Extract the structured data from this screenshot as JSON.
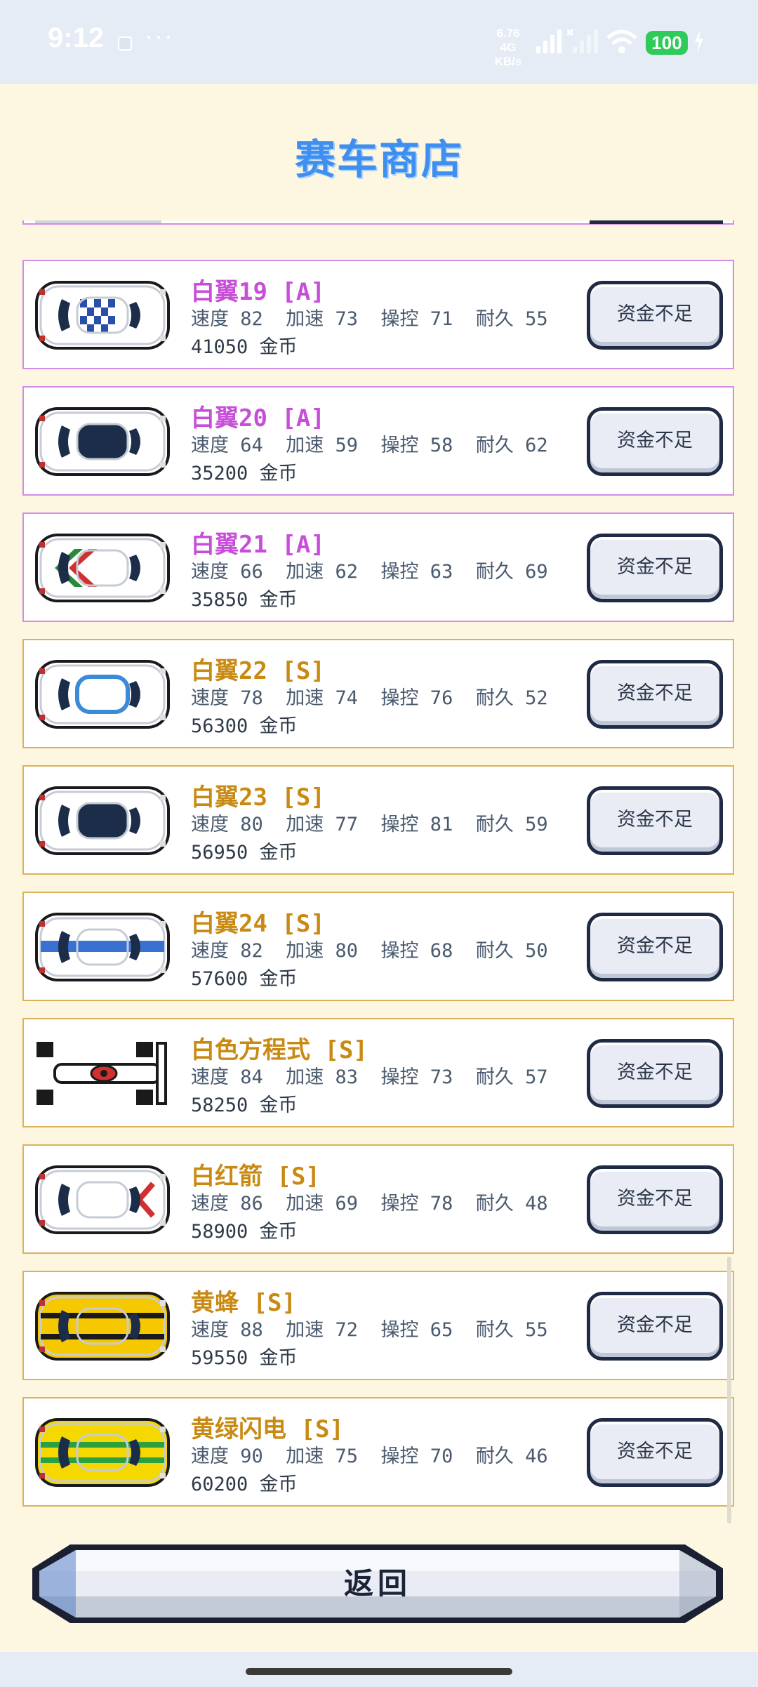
{
  "status_bar": {
    "time": "9:12",
    "more": "···",
    "net_speed": "6.76",
    "net_unit": "KB/s",
    "net_type": "4G",
    "battery": "100"
  },
  "page_title": "赛车商店",
  "cars": [
    {
      "name": "白翼19 [A]",
      "tier": "a",
      "stats": "速度 82  加速 73  操控 71  耐久 55",
      "price": "41050 金币",
      "button": "资金不足"
    },
    {
      "name": "白翼20 [A]",
      "tier": "a",
      "stats": "速度 64  加速 59  操控 58  耐久 62",
      "price": "35200 金币",
      "button": "资金不足"
    },
    {
      "name": "白翼21 [A]",
      "tier": "a",
      "stats": "速度 66  加速 62  操控 63  耐久 69",
      "price": "35850 金币",
      "button": "资金不足"
    },
    {
      "name": "白翼22 [S]",
      "tier": "s",
      "stats": "速度 78  加速 74  操控 76  耐久 52",
      "price": "56300 金币",
      "button": "资金不足"
    },
    {
      "name": "白翼23 [S]",
      "tier": "s",
      "stats": "速度 80  加速 77  操控 81  耐久 59",
      "price": "56950 金币",
      "button": "资金不足"
    },
    {
      "name": "白翼24 [S]",
      "tier": "s",
      "stats": "速度 82  加速 80  操控 68  耐久 50",
      "price": "57600 金币",
      "button": "资金不足"
    },
    {
      "name": "白色方程式 [S]",
      "tier": "s",
      "stats": "速度 84  加速 83  操控 73  耐久 57",
      "price": "58250 金币",
      "button": "资金不足"
    },
    {
      "name": "白红箭 [S]",
      "tier": "s",
      "stats": "速度 86  加速 69  操控 78  耐久 48",
      "price": "58900 金币",
      "button": "资金不足"
    },
    {
      "name": "黄蜂 [S]",
      "tier": "s",
      "stats": "速度 88  加速 72  操控 65  耐久 55",
      "price": "59550 金币",
      "button": "资金不足"
    },
    {
      "name": "黄绿闪电 [S]",
      "tier": "s",
      "stats": "速度 90  加速 75  操控 70  耐久 46",
      "price": "60200 金币",
      "button": "资金不足"
    }
  ],
  "back_button": "返回",
  "colors": {
    "title": "#3f8ff0",
    "tier_a": "#c74ed8",
    "tier_s": "#c98a14",
    "card_border_a": "#d48ce8",
    "card_border_s": "#dcb35a"
  }
}
